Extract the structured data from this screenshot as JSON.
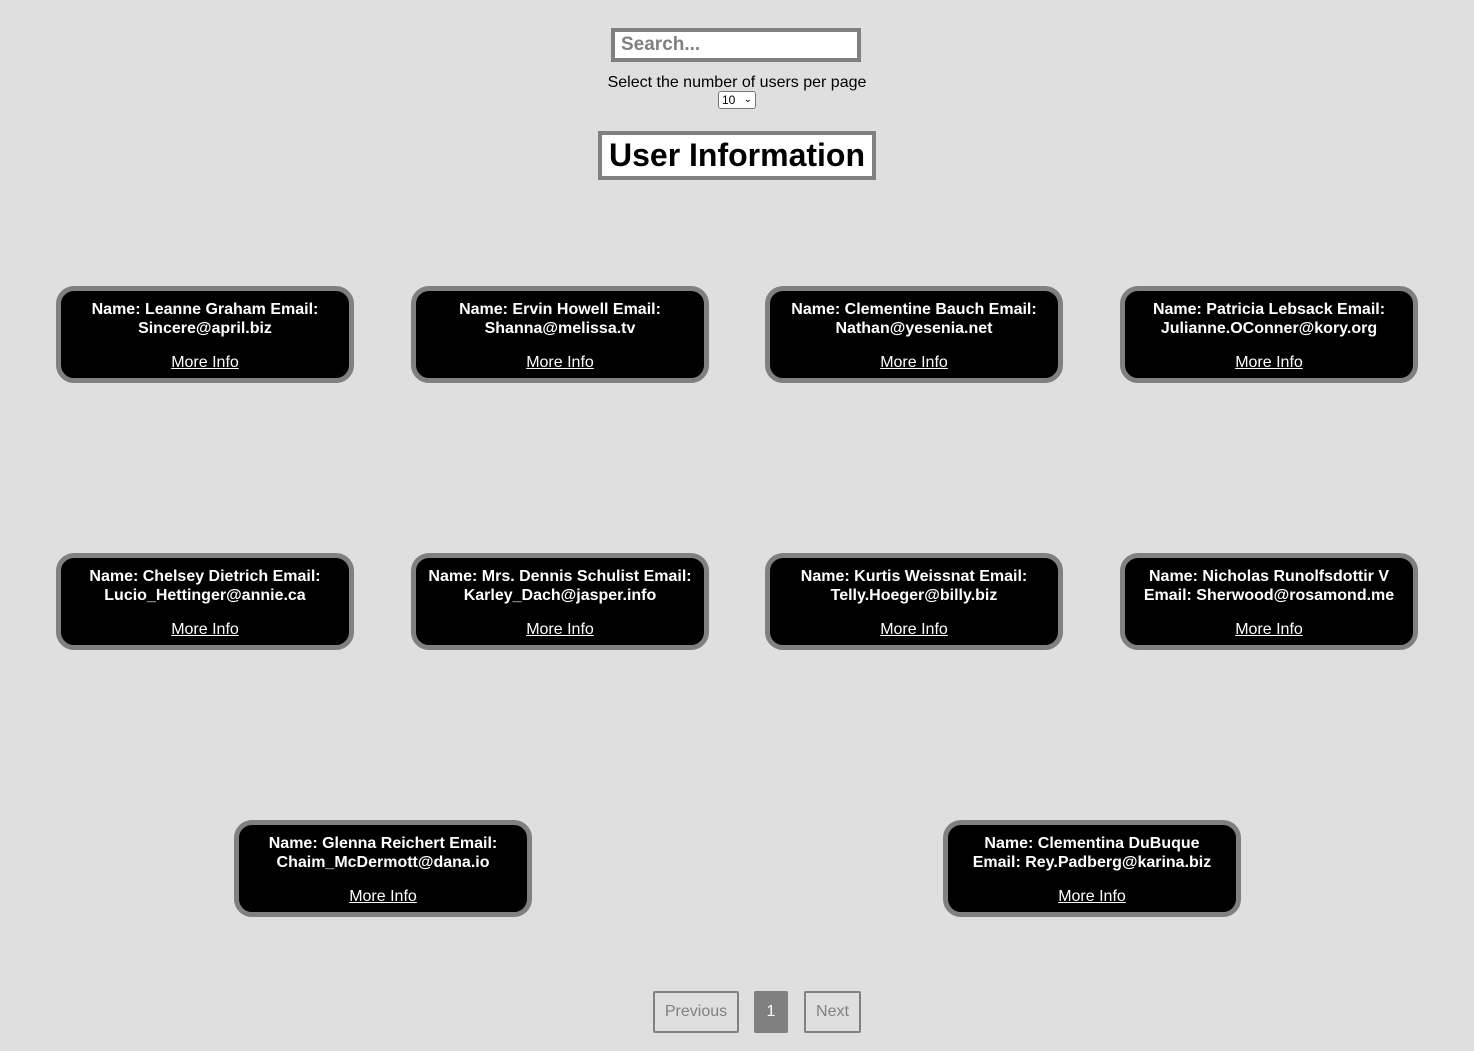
{
  "search": {
    "placeholder": "Search..."
  },
  "per_page": {
    "label": "Select the number of users per page",
    "selected": "10"
  },
  "heading": "User Information",
  "users": [
    {
      "info": "Name: Leanne Graham Email: Sincere@april.biz",
      "link": "More Info"
    },
    {
      "info": "Name: Ervin Howell Email: Shanna@melissa.tv",
      "link": "More Info"
    },
    {
      "info": "Name: Clementine Bauch Email: Nathan@yesenia.net",
      "link": "More Info"
    },
    {
      "info": "Name: Patricia Lebsack Email: Julianne.OConner@kory.org",
      "link": "More Info"
    },
    {
      "info": "Name: Chelsey Dietrich Email: Lucio_Hettinger@annie.ca",
      "link": "More Info"
    },
    {
      "info": "Name: Mrs. Dennis Schulist Email: Karley_Dach@jasper.info",
      "link": "More Info"
    },
    {
      "info": "Name: Kurtis Weissnat Email: Telly.Hoeger@billy.biz",
      "link": "More Info"
    },
    {
      "info": "Name: Nicholas Runolfsdottir V Email: Sherwood@rosamond.me",
      "link": "More Info"
    },
    {
      "info": "Name: Glenna Reichert Email: Chaim_McDermott@dana.io",
      "link": "More Info"
    },
    {
      "info": "Name: Clementina DuBuque Email: Rey.Padberg@karina.biz",
      "link": "More Info"
    }
  ],
  "pagination": {
    "previous": "Previous",
    "current": "1",
    "next": "Next"
  },
  "colors": {
    "background": "#e0dfe0",
    "card": "#000000",
    "border": "#808080"
  }
}
